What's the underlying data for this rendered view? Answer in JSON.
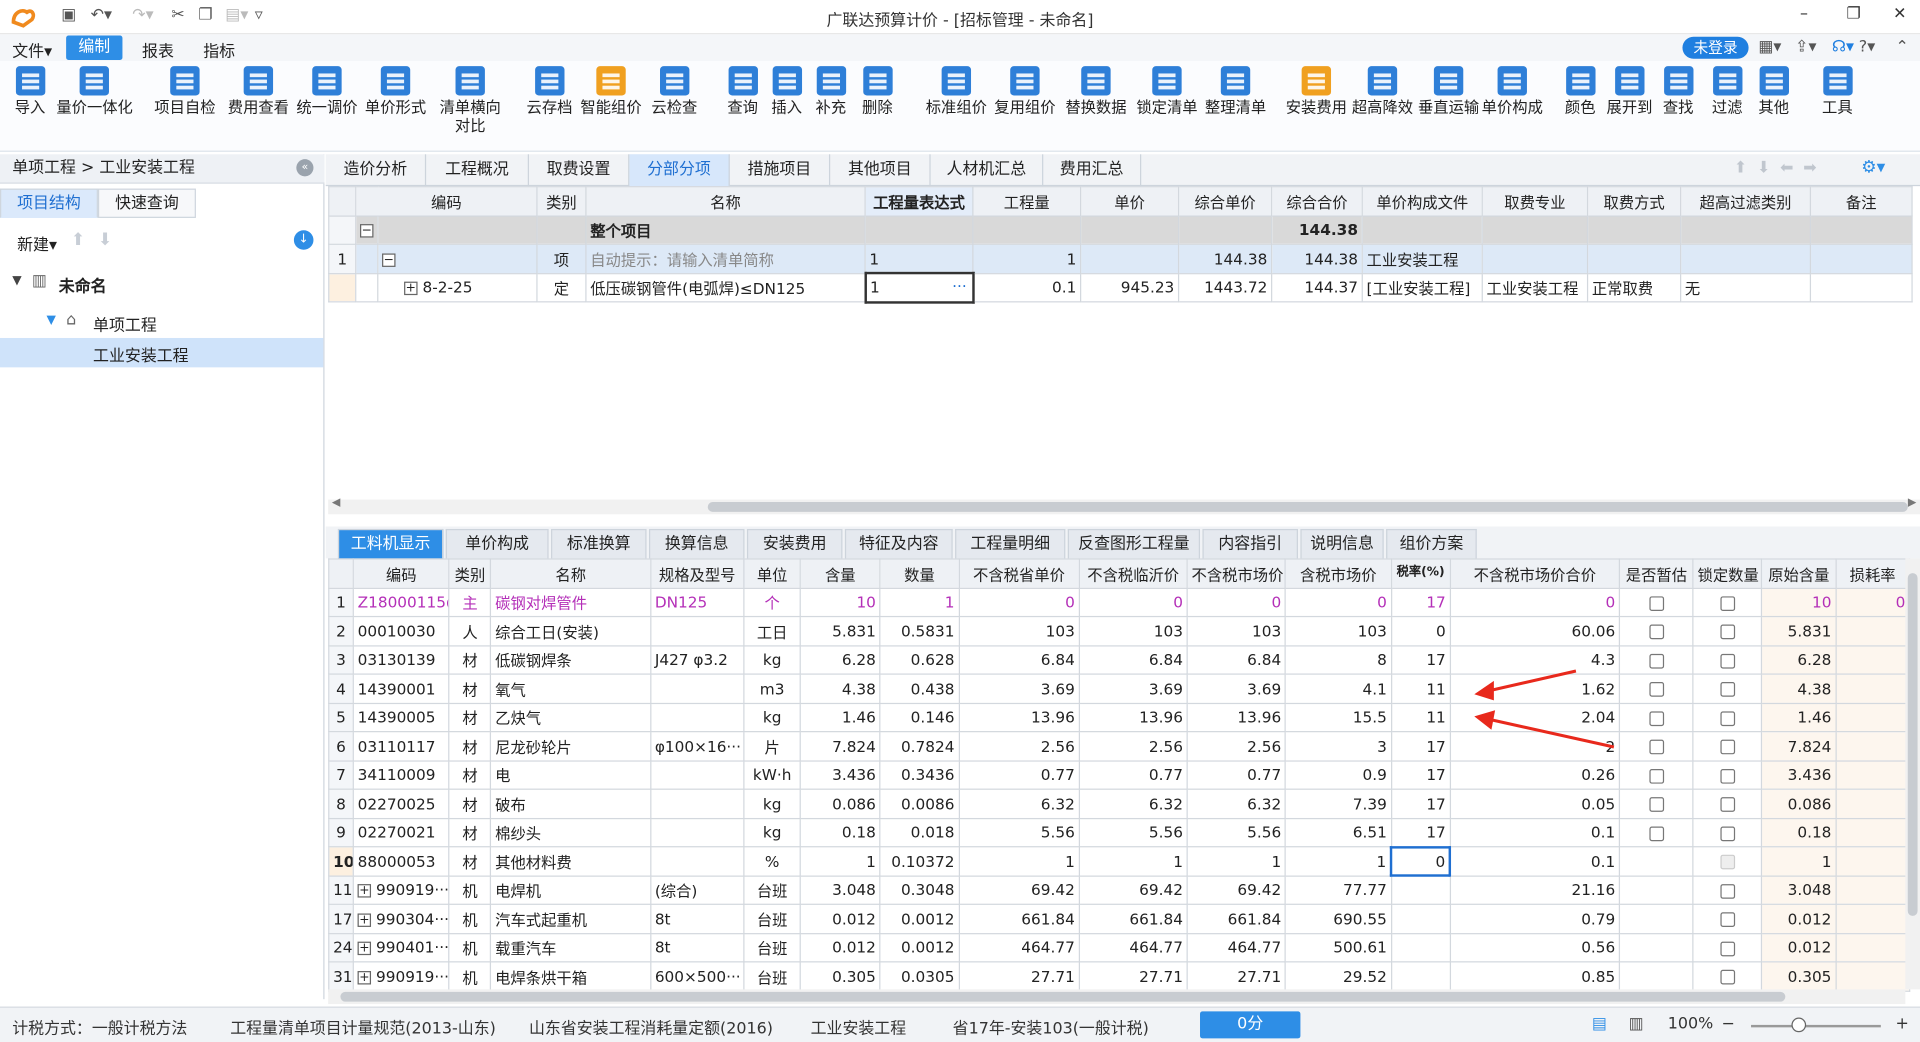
{
  "window": {
    "title": "广联达预算计价 - [招标管理 - 未命名]"
  },
  "menu": {
    "items": [
      "文件▾",
      "编制",
      "报表",
      "指标"
    ],
    "login": "未登录"
  },
  "toolbar": {
    "buttons": [
      {
        "label": "导入",
        "color": "#2e7fd8"
      },
      {
        "label": "量价一体化",
        "color": "#2e7fd8"
      },
      {
        "label": "项目自检",
        "color": "#2e7fd8"
      },
      {
        "label": "费用查看",
        "color": "#2e7fd8"
      },
      {
        "label": "统一调价",
        "color": "#2e7fd8"
      },
      {
        "label": "单价形式",
        "color": "#2e7fd8"
      },
      {
        "label": "清单横向对比",
        "color": "#2e7fd8"
      },
      {
        "label": "云存档",
        "color": "#2e7fd8"
      },
      {
        "label": "智能组价",
        "color": "#f0a020"
      },
      {
        "label": "云检查",
        "color": "#2e7fd8"
      },
      {
        "label": "查询",
        "color": "#2e7fd8"
      },
      {
        "label": "插入",
        "color": "#2e7fd8"
      },
      {
        "label": "补充",
        "color": "#2e7fd8"
      },
      {
        "label": "删除",
        "color": "#2e7fd8"
      },
      {
        "label": "标准组价",
        "color": "#2e7fd8"
      },
      {
        "label": "复用组价",
        "color": "#2e7fd8"
      },
      {
        "label": "替换数据",
        "color": "#2e7fd8"
      },
      {
        "label": "锁定清单",
        "color": "#2e7fd8"
      },
      {
        "label": "整理清单",
        "color": "#2e7fd8"
      },
      {
        "label": "安装费用",
        "color": "#f0a020"
      },
      {
        "label": "超高降效",
        "color": "#2e7fd8"
      },
      {
        "label": "垂直运输",
        "color": "#2e7fd8"
      },
      {
        "label": "单价构成",
        "color": "#2e7fd8"
      },
      {
        "label": "颜色",
        "color": "#2e7fd8"
      },
      {
        "label": "展开到",
        "color": "#2e7fd8"
      },
      {
        "label": "查找",
        "color": "#2e7fd8"
      },
      {
        "label": "过滤",
        "color": "#2e7fd8"
      },
      {
        "label": "其他",
        "color": "#2e7fd8"
      },
      {
        "label": "工具",
        "color": "#2e7fd8"
      }
    ]
  },
  "left": {
    "breadcrumb": "单项工程 > 工业安装工程",
    "tabs": [
      "项目结构",
      "快速查询"
    ],
    "new_label": "新建▾",
    "tree": [
      "未命名",
      "单项工程",
      "工业安装工程"
    ]
  },
  "top_tabs": [
    "造价分析",
    "工程概况",
    "取费设置",
    "分部分项",
    "措施项目",
    "其他项目",
    "人材机汇总",
    "费用汇总"
  ],
  "upper_table": {
    "headers": [
      "编码",
      "类别",
      "名称",
      "工程量表达式",
      "工程量",
      "单价",
      "综合单价",
      "综合合价",
      "单价构成文件",
      "取费专业",
      "取费方式",
      "超高过滤类别",
      "备注"
    ],
    "whole": {
      "label": "整个项目",
      "total": "144.38"
    },
    "row1": {
      "num": "1",
      "type": "项",
      "name": "自动提示：请输入清单简称",
      "expr": "1",
      "qty": "1",
      "unit_price": "",
      "comp_price": "144.38",
      "comp_total": "144.38",
      "file": "工业安装工程"
    },
    "row2": {
      "code": "8-2-25",
      "type": "定",
      "name": "低压碳钢管件(电弧焊)≤DN125",
      "expr": "1",
      "qty": "0.1",
      "unit_price": "945.23",
      "comp_price": "1443.72",
      "comp_total": "144.37",
      "file": "[工业安装工程]",
      "major": "工业安装工程",
      "method": "正常取费",
      "filter": "无"
    }
  },
  "bottom_tabs": [
    "工料机显示",
    "单价构成",
    "标准换算",
    "换算信息",
    "安装费用",
    "特征及内容",
    "工程量明细",
    "反查图形工程量",
    "内容指引",
    "说明信息",
    "组价方案"
  ],
  "lower_table": {
    "headers": [
      "编码",
      "类别",
      "名称",
      "规格及型号",
      "单位",
      "含量",
      "数量",
      "不含税省单价",
      "不含税临沂价",
      "不含税市场价",
      "含税市场价",
      "税率(%)",
      "不含税市场价合价",
      "是否暂估",
      "锁定数量",
      "原始含量",
      "损耗率"
    ],
    "rows": [
      {
        "n": "1",
        "code": "Z18000115@1",
        "type": "主",
        "name": "碳钢对焊管件",
        "spec": "DN125",
        "unit": "个",
        "content": "10",
        "qty": "1",
        "p1": "0",
        "p2": "0",
        "p3": "0",
        "p4": "0",
        "tax": "17",
        "total": "0",
        "orig": "10",
        "loss": "0"
      },
      {
        "n": "2",
        "code": "00010030",
        "type": "人",
        "name": "综合工日(安装)",
        "spec": "",
        "unit": "工日",
        "content": "5.831",
        "qty": "0.5831",
        "p1": "103",
        "p2": "103",
        "p3": "103",
        "p4": "103",
        "tax": "0",
        "total": "60.06",
        "orig": "5.831",
        "loss": ""
      },
      {
        "n": "3",
        "code": "03130139",
        "type": "材",
        "name": "低碳钢焊条",
        "spec": "J427 φ3.2",
        "unit": "kg",
        "content": "6.28",
        "qty": "0.628",
        "p1": "6.84",
        "p2": "6.84",
        "p3": "6.84",
        "p4": "8",
        "tax": "17",
        "total": "4.3",
        "orig": "6.28",
        "loss": ""
      },
      {
        "n": "4",
        "code": "14390001",
        "type": "材",
        "name": "氧气",
        "spec": "",
        "unit": "m3",
        "content": "4.38",
        "qty": "0.438",
        "p1": "3.69",
        "p2": "3.69",
        "p3": "3.69",
        "p4": "4.1",
        "tax": "11",
        "total": "1.62",
        "orig": "4.38",
        "loss": ""
      },
      {
        "n": "5",
        "code": "14390005",
        "type": "材",
        "name": "乙炔气",
        "spec": "",
        "unit": "kg",
        "content": "1.46",
        "qty": "0.146",
        "p1": "13.96",
        "p2": "13.96",
        "p3": "13.96",
        "p4": "15.5",
        "tax": "11",
        "total": "2.04",
        "orig": "1.46",
        "loss": ""
      },
      {
        "n": "6",
        "code": "03110117",
        "type": "材",
        "name": "尼龙砂轮片",
        "spec": "φ100×16···",
        "unit": "片",
        "content": "7.824",
        "qty": "0.7824",
        "p1": "2.56",
        "p2": "2.56",
        "p3": "2.56",
        "p4": "3",
        "tax": "17",
        "total": "2",
        "orig": "7.824",
        "loss": ""
      },
      {
        "n": "7",
        "code": "34110009",
        "type": "材",
        "name": "电",
        "spec": "",
        "unit": "kW·h",
        "content": "3.436",
        "qty": "0.3436",
        "p1": "0.77",
        "p2": "0.77",
        "p3": "0.77",
        "p4": "0.9",
        "tax": "17",
        "total": "0.26",
        "orig": "3.436",
        "loss": ""
      },
      {
        "n": "8",
        "code": "02270025",
        "type": "材",
        "name": "破布",
        "spec": "",
        "unit": "kg",
        "content": "0.086",
        "qty": "0.0086",
        "p1": "6.32",
        "p2": "6.32",
        "p3": "6.32",
        "p4": "7.39",
        "tax": "17",
        "total": "0.05",
        "orig": "0.086",
        "loss": ""
      },
      {
        "n": "9",
        "code": "02270021",
        "type": "材",
        "name": "棉纱头",
        "spec": "",
        "unit": "kg",
        "content": "0.18",
        "qty": "0.018",
        "p1": "5.56",
        "p2": "5.56",
        "p3": "5.56",
        "p4": "6.51",
        "tax": "17",
        "total": "0.1",
        "orig": "0.18",
        "loss": ""
      },
      {
        "n": "10",
        "code": "88000053",
        "type": "材",
        "name": "其他材料费",
        "spec": "",
        "unit": "%",
        "content": "1",
        "qty": "0.10372",
        "p1": "1",
        "p2": "1",
        "p3": "1",
        "p4": "1",
        "tax": "0",
        "total": "0.1",
        "orig": "1",
        "loss": ""
      },
      {
        "n": "11",
        "code": "990919···",
        "type": "机",
        "name": "电焊机",
        "spec": "(综合)",
        "unit": "台班",
        "content": "3.048",
        "qty": "0.3048",
        "p1": "69.42",
        "p2": "69.42",
        "p3": "69.42",
        "p4": "77.77",
        "tax": "",
        "total": "21.16",
        "orig": "3.048",
        "loss": ""
      },
      {
        "n": "17",
        "code": "990304···",
        "type": "机",
        "name": "汽车式起重机",
        "spec": "8t",
        "unit": "台班",
        "content": "0.012",
        "qty": "0.0012",
        "p1": "661.84",
        "p2": "661.84",
        "p3": "661.84",
        "p4": "690.55",
        "tax": "",
        "total": "0.79",
        "orig": "0.012",
        "loss": ""
      },
      {
        "n": "24",
        "code": "990401···",
        "type": "机",
        "name": "载重汽车",
        "spec": "8t",
        "unit": "台班",
        "content": "0.012",
        "qty": "0.0012",
        "p1": "464.77",
        "p2": "464.77",
        "p3": "464.77",
        "p4": "500.61",
        "tax": "",
        "total": "0.56",
        "orig": "0.012",
        "loss": ""
      },
      {
        "n": "31",
        "code": "990919···",
        "type": "机",
        "name": "电焊条烘干箱",
        "spec": "600×500···",
        "unit": "台班",
        "content": "0.305",
        "qty": "0.0305",
        "p1": "27.71",
        "p2": "27.71",
        "p3": "27.71",
        "p4": "29.52",
        "tax": "",
        "total": "0.85",
        "orig": "0.305",
        "loss": ""
      }
    ]
  },
  "status": {
    "items": [
      "计税方式：一般计税方法",
      "工程量清单项目计量规范(2013-山东)",
      "山东省安装工程消耗量定额(2016)",
      "工业安装工程",
      "省17年-安装103(一般计税)"
    ],
    "score": "0分",
    "zoom": "100%"
  }
}
